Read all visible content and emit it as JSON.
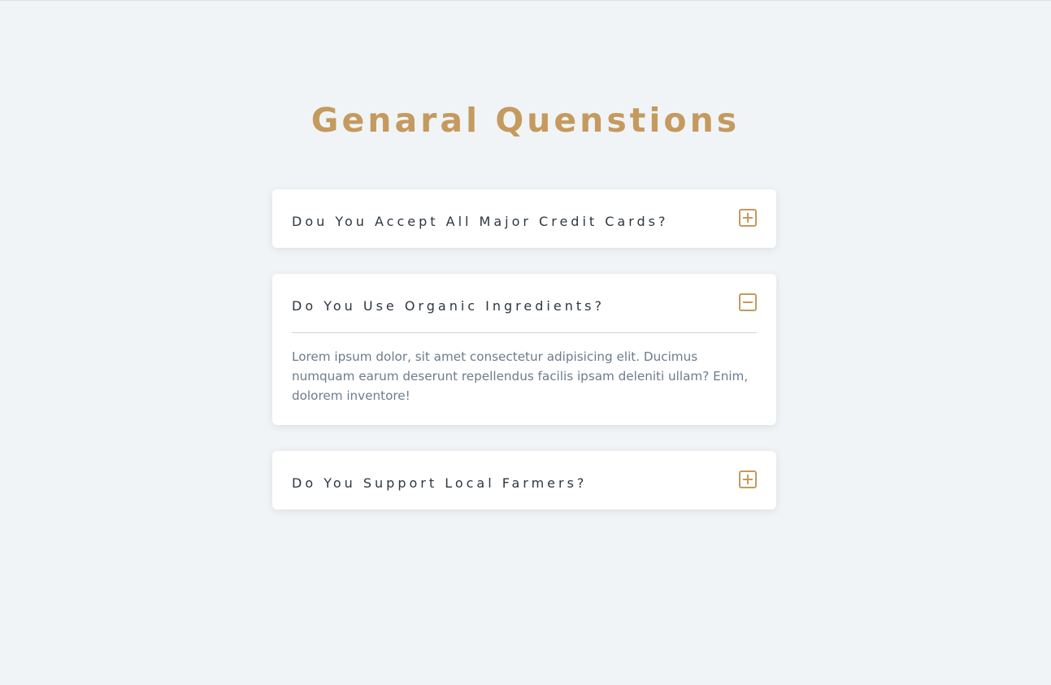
{
  "page": {
    "title": "Genaral Quenstions"
  },
  "faq": {
    "items": [
      {
        "question": "Dou You Accept All Major Credit Cards?",
        "icon": "plus-square-icon",
        "expanded": false
      },
      {
        "question": "Do You Use Organic Ingredients?",
        "icon": "minus-square-icon",
        "expanded": true,
        "answer": "Lorem ipsum dolor, sit amet consectetur adipisicing elit. Ducimus numquam earum deserunt repellendus facilis ipsam deleniti ullam? Enim, dolorem inventore!"
      },
      {
        "question": "Do You Support Local Farmers?",
        "icon": "plus-square-icon",
        "expanded": false
      }
    ]
  },
  "colors": {
    "background": "#f1f4f7",
    "accent": "#c49a5e",
    "card": "#ffffff",
    "question_text": "#2d3640",
    "answer_text": "#6c7c8c"
  }
}
